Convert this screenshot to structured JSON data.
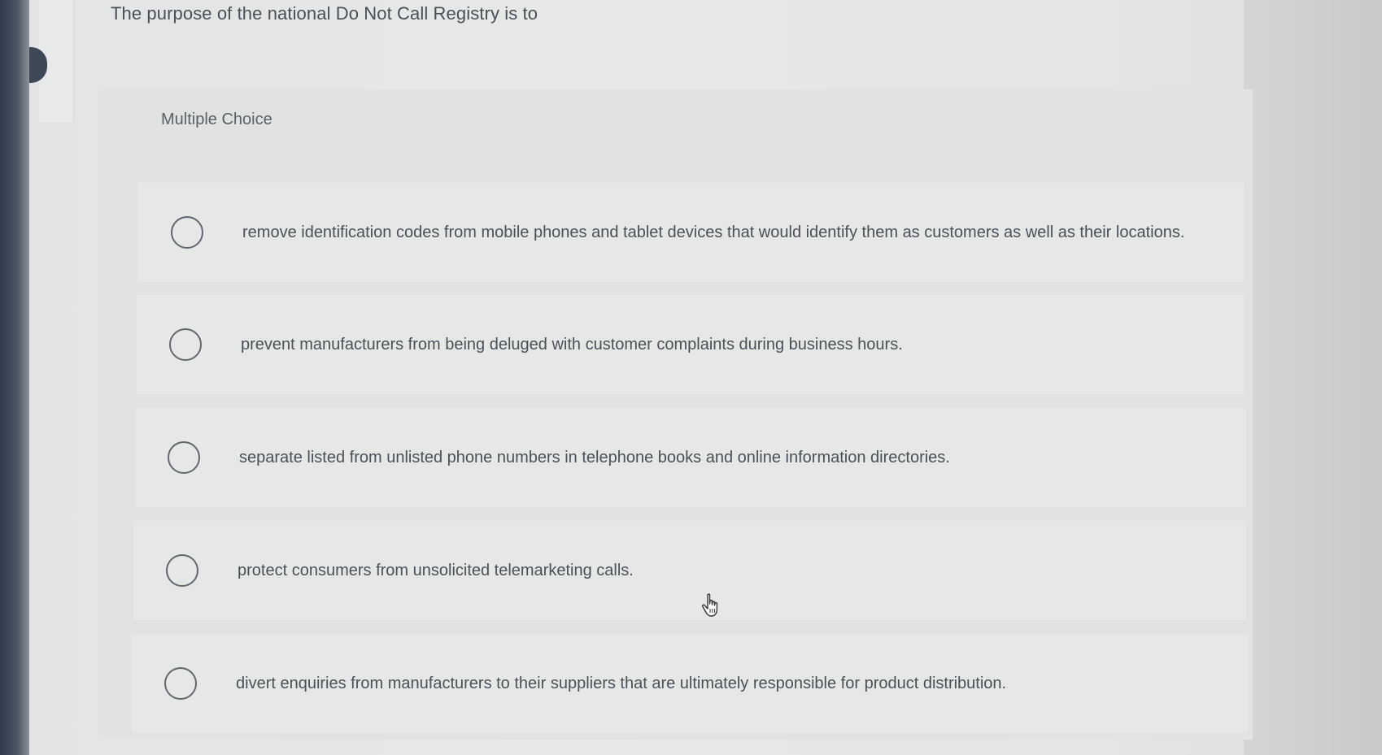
{
  "question": {
    "text": "The purpose of the national Do Not Call Registry is to"
  },
  "question_type": "Multiple Choice",
  "options": [
    {
      "label": "remove identification codes from mobile phones and tablet devices that would identify them as customers as well as their locations.",
      "selected": false
    },
    {
      "label": "prevent manufacturers from being deluged with customer complaints during business hours.",
      "selected": false
    },
    {
      "label": "separate listed from unlisted phone numbers in telephone books and online information directories.",
      "selected": false
    },
    {
      "label": "protect consumers from unsolicited telemarketing calls.",
      "selected": false
    },
    {
      "label": "divert enquiries from manufacturers to their suppliers that are ultimately responsible for product distribution.",
      "selected": false
    }
  ],
  "icons": {
    "radio": "radio-unchecked-icon",
    "cursor": "hand-pointer-icon"
  }
}
